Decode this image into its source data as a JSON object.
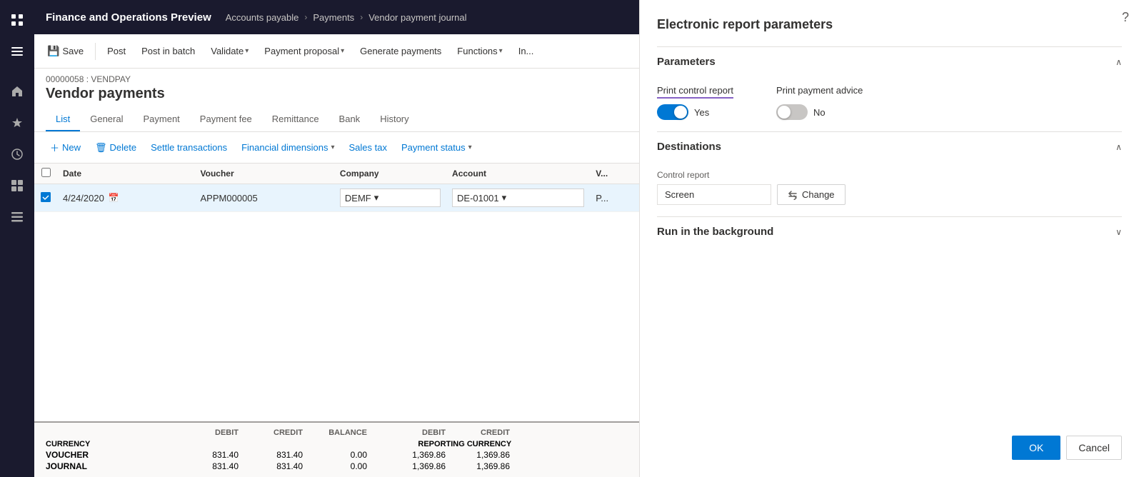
{
  "app": {
    "title": "Finance and Operations Preview",
    "help_icon": "?"
  },
  "breadcrumb": {
    "items": [
      "Accounts payable",
      "Payments",
      "Vendor payment journal"
    ],
    "separators": [
      ">",
      ">"
    ]
  },
  "toolbar": {
    "buttons": [
      {
        "id": "save",
        "label": "Save",
        "icon": "💾"
      },
      {
        "id": "post",
        "label": "Post",
        "icon": null
      },
      {
        "id": "post-batch",
        "label": "Post in batch",
        "icon": null
      },
      {
        "id": "validate",
        "label": "Validate",
        "icon": null,
        "dropdown": true
      },
      {
        "id": "payment-proposal",
        "label": "Payment proposal",
        "icon": null,
        "dropdown": true
      },
      {
        "id": "generate-payments",
        "label": "Generate payments",
        "icon": null
      },
      {
        "id": "functions",
        "label": "Functions",
        "icon": null,
        "dropdown": true
      },
      {
        "id": "inquiries",
        "label": "In...",
        "icon": null
      }
    ]
  },
  "journal": {
    "id": "00000058 : VENDPAY",
    "title": "Vendor payments"
  },
  "tabs": [
    {
      "id": "list",
      "label": "List",
      "active": true
    },
    {
      "id": "general",
      "label": "General"
    },
    {
      "id": "payment",
      "label": "Payment"
    },
    {
      "id": "payment-fee",
      "label": "Payment fee"
    },
    {
      "id": "remittance",
      "label": "Remittance"
    },
    {
      "id": "bank",
      "label": "Bank"
    },
    {
      "id": "history",
      "label": "History"
    }
  ],
  "table_toolbar": {
    "new_btn": "New",
    "delete_btn": "Delete",
    "settle_btn": "Settle transactions",
    "financial_btn": "Financial dimensions",
    "sales_tax_btn": "Sales tax",
    "payment_status_btn": "Payment status"
  },
  "table": {
    "columns": [
      "",
      "Date",
      "Voucher",
      "Company",
      "Account",
      "V..."
    ],
    "rows": [
      {
        "selected": true,
        "date": "4/24/2020",
        "voucher": "APPM000005",
        "company": "DEMF",
        "account": "DE-01001",
        "v": "P..."
      }
    ]
  },
  "summary": {
    "currency_label": "CURRENCY",
    "reporting_currency_label": "REPORTING CURRENCY",
    "debit_label": "DEBIT",
    "credit_label": "CREDIT",
    "balance_label": "BALANCE",
    "rows": [
      {
        "label": "VOUCHER",
        "debit": "831.40",
        "credit": "831.40",
        "balance": "0.00",
        "rep_debit": "1,369.86",
        "rep_credit": "1,369.86",
        "rep_balance": ""
      },
      {
        "label": "JOURNAL",
        "debit": "831.40",
        "credit": "831.40",
        "balance": "0.00",
        "rep_debit": "1,369.86",
        "rep_credit": "1,369.86",
        "rep_balance": ""
      }
    ]
  },
  "right_panel": {
    "title": "Electronic report parameters",
    "parameters_label": "Parameters",
    "print_control_report_label": "Print control report",
    "print_control_report_value": "Yes",
    "print_control_report_on": true,
    "print_payment_advice_label": "Print payment advice",
    "print_payment_advice_value": "No",
    "print_payment_advice_on": false,
    "destinations_label": "Destinations",
    "control_report_label": "Control report",
    "screen_value": "Screen",
    "change_btn_label": "Change",
    "run_bg_label": "Run in the background",
    "ok_label": "OK",
    "cancel_label": "Cancel"
  },
  "sidebar": {
    "icons": [
      {
        "id": "grid",
        "symbol": "⊞"
      },
      {
        "id": "home",
        "symbol": "⌂"
      },
      {
        "id": "star",
        "symbol": "★"
      },
      {
        "id": "recent",
        "symbol": "🕐"
      },
      {
        "id": "dashboard",
        "symbol": "▦"
      },
      {
        "id": "list",
        "symbol": "☰"
      }
    ]
  }
}
